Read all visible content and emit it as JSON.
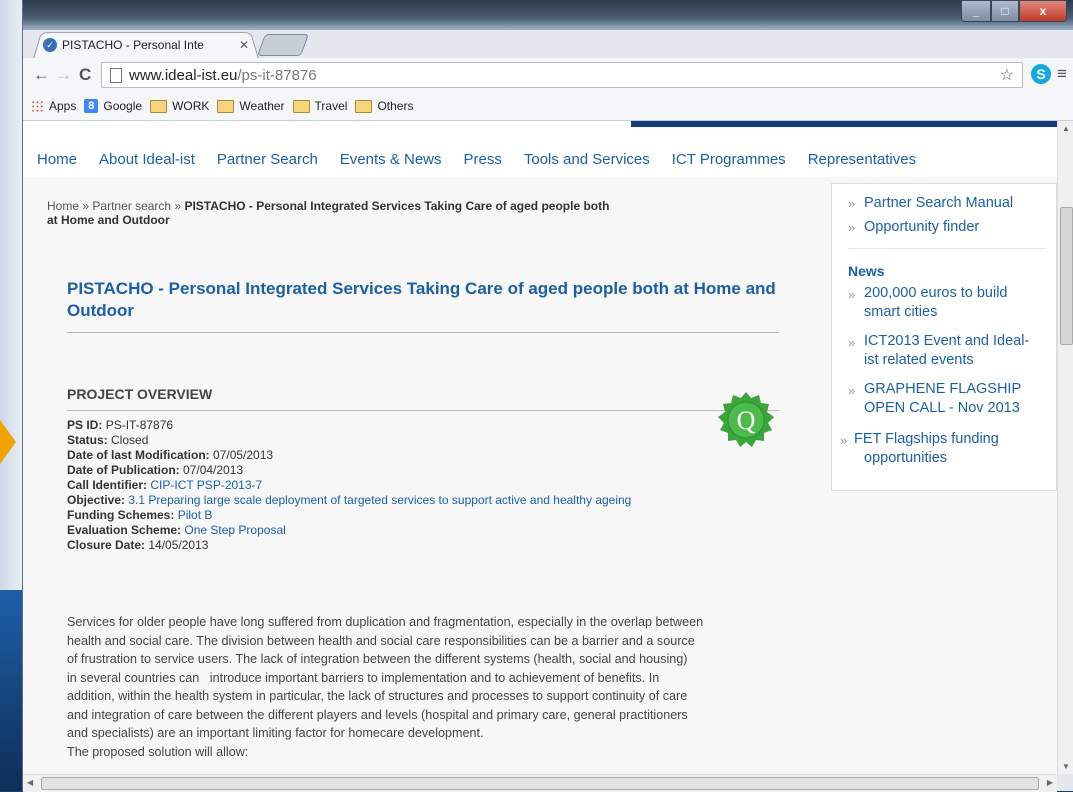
{
  "browser": {
    "tab_title": "PISTACHO - Personal Inte",
    "url_host": "www.ideal-ist.eu",
    "url_path": "/ps-it-87876",
    "bookmarks": [
      "Apps",
      "Google",
      "WORK",
      "Weather",
      "Travel",
      "Others"
    ]
  },
  "site": {
    "nav": [
      "Home",
      "About Ideal-ist",
      "Partner Search",
      "Events & News",
      "Press",
      "Tools and Services",
      "ICT Programmes",
      "Representatives"
    ],
    "breadcrumb": {
      "home": "Home",
      "sep": "»",
      "partner": "Partner search",
      "current_line1": "PISTACHO - Personal Integrated Services Taking Care of aged people both",
      "current_line2": "at Home and Outdoor"
    },
    "title": "PISTACHO - Personal Integrated Services Taking Care of aged people both at Home and Outdoor",
    "overview_heading": "PROJECT OVERVIEW",
    "badge_letter": "Q",
    "fields": [
      {
        "label": "PS ID:",
        "value": "PS-IT-87876",
        "link": false
      },
      {
        "label": "Status:",
        "value": "Closed",
        "link": false
      },
      {
        "label": "Date of last Modification:",
        "value": "07/05/2013",
        "link": false
      },
      {
        "label": "Date of Publication:",
        "value": "07/04/2013",
        "link": false
      },
      {
        "label": "Call Identifier:",
        "value": "CIP-ICT PSP-2013-7",
        "link": true
      },
      {
        "label": "Objective:",
        "value": "3.1 Preparing large scale deployment of targeted services to support active and healthy ageing",
        "link": true
      },
      {
        "label": "Funding Schemes:",
        "value": "Pilot B",
        "link": true
      },
      {
        "label": "Evaluation Scheme:",
        "value": "One Step Proposal",
        "link": true
      },
      {
        "label": "Closure Date:",
        "value": "14/05/2013",
        "link": false
      }
    ],
    "description": [
      "Services for older people have long suffered from duplication and fragmentation, especially in the overlap between",
      "health and social care. The division between health and social care responsibilities can be a barrier and a source",
      "of frustration to service users. The lack of integration between the different systems (health, social and housing)",
      "in several countries can   introduce important barriers to implementation and to achievement of benefits. In",
      "addition, within the health system in particular, the lack of structures and processes to support continuity of care",
      "and integration of care between the different players and levels (hospital and primary care, general practitioners",
      "and specialists) are an important limiting factor for homecare development.",
      "The proposed solution will allow:"
    ],
    "sidebar": {
      "links": [
        "Partner Search Manual",
        "Opportunity finder"
      ],
      "news_title": "News",
      "news": [
        {
          "line1": "200,000 euros to build",
          "line2": "smart cities"
        },
        {
          "line1": "ICT2013 Event and Ideal-",
          "line2": "ist related events"
        },
        {
          "line1": "GRAPHENE FLAGSHIP",
          "line2": "OPEN CALL - Nov 2013"
        },
        {
          "line1": "FET Flagships funding",
          "line2": "opportunities"
        }
      ]
    }
  },
  "colors": {
    "link": "#1c5fa6",
    "brand_bar": "#173c7a",
    "badge": "#3aa53a"
  }
}
